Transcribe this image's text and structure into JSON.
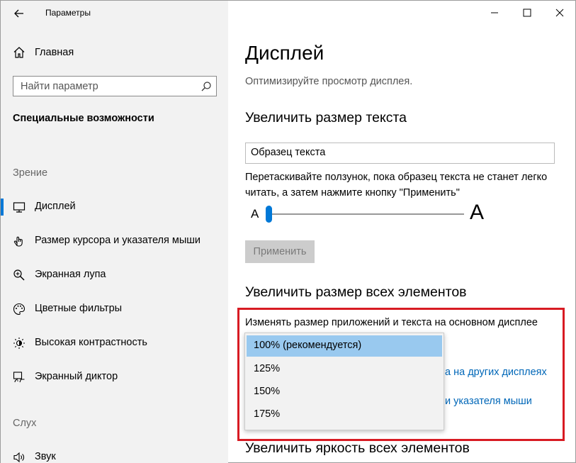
{
  "app": {
    "title": "Параметры"
  },
  "sidebar": {
    "home": "Главная",
    "search_placeholder": "Найти параметр",
    "section": "Специальные возможности",
    "groups": {
      "vision": "Зрение",
      "hearing": "Слух"
    },
    "items": [
      {
        "label": "Дисплей",
        "icon": "monitor-icon",
        "selected": true
      },
      {
        "label": "Размер курсора и указателя мыши",
        "icon": "cursor-icon"
      },
      {
        "label": "Экранная лупа",
        "icon": "magnifier-icon"
      },
      {
        "label": "Цветные фильтры",
        "icon": "palette-icon"
      },
      {
        "label": "Высокая контрастность",
        "icon": "contrast-icon"
      },
      {
        "label": "Экранный диктор",
        "icon": "narrator-icon"
      },
      {
        "label": "Звук",
        "icon": "speaker-icon"
      }
    ]
  },
  "main": {
    "title": "Дисплей",
    "subtitle": "Оптимизируйте просмотр дисплея.",
    "text_size": {
      "heading": "Увеличить размер текста",
      "sample": "Образец текста",
      "hint": "Перетаскивайте ползунок, пока образец текста не станет легко читать, а затем нажмите кнопку \"Применить\"",
      "small_label": "A",
      "big_label": "A",
      "slider_value_percent": 0,
      "apply_label": "Применить"
    },
    "scale": {
      "heading": "Увеличить размер всех элементов",
      "description": "Изменять размер приложений и текста на основном дисплее",
      "link1_tail": "а на других дисплеях",
      "link2_tail": "и указателя мыши",
      "options": [
        "100% (рекомендуется)",
        "125%",
        "150%",
        "175%"
      ],
      "selected": "100% (рекомендуется)"
    },
    "brightness": {
      "heading": "Увеличить яркость всех элементов"
    }
  },
  "colors": {
    "accent": "#0078d7",
    "highlight": "#d81b23",
    "selection": "#99c9ef"
  }
}
